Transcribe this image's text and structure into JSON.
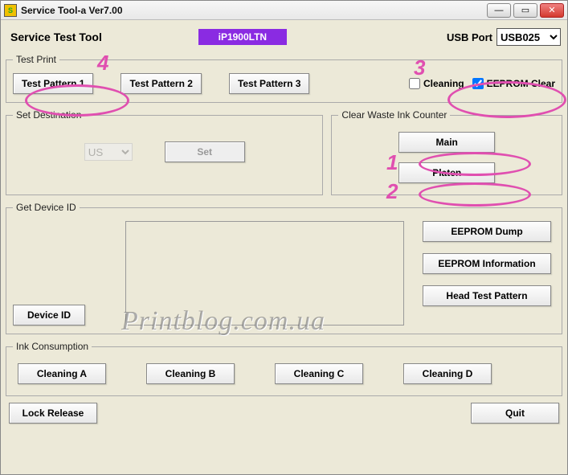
{
  "window": {
    "title": "Service Tool-a Ver7.00"
  },
  "header": {
    "label": "Service Test Tool",
    "model": "iP1900LTN",
    "usb_label": "USB Port",
    "usb_value": "USB025"
  },
  "test_print": {
    "legend": "Test Print",
    "btn1": "Test Pattern 1",
    "btn2": "Test Pattern 2",
    "btn3": "Test Pattern 3",
    "cleaning_label": "Cleaning",
    "cleaning_checked": false,
    "eeprom_clear_label": "EEPROM Clear",
    "eeprom_clear_checked": true
  },
  "set_destination": {
    "legend": "Set Destination",
    "region": "US",
    "set_btn": "Set"
  },
  "clear_waste": {
    "legend": "Clear Waste Ink Counter",
    "main_btn": "Main",
    "platen_btn": "Platen"
  },
  "get_device": {
    "legend": "Get Device ID",
    "device_id_btn": "Device ID",
    "eeprom_dump_btn": "EEPROM Dump",
    "eeprom_info_btn": "EEPROM Information",
    "head_test_btn": "Head Test Pattern"
  },
  "ink": {
    "legend": "Ink Consumption",
    "a": "Cleaning A",
    "b": "Cleaning B",
    "c": "Cleaning C",
    "d": "Cleaning D"
  },
  "footer": {
    "lock_release": "Lock Release",
    "quit": "Quit"
  },
  "annotations": {
    "n1": "1",
    "n2": "2",
    "n3": "3",
    "n4": "4"
  },
  "watermark": "Printblog.com.ua"
}
